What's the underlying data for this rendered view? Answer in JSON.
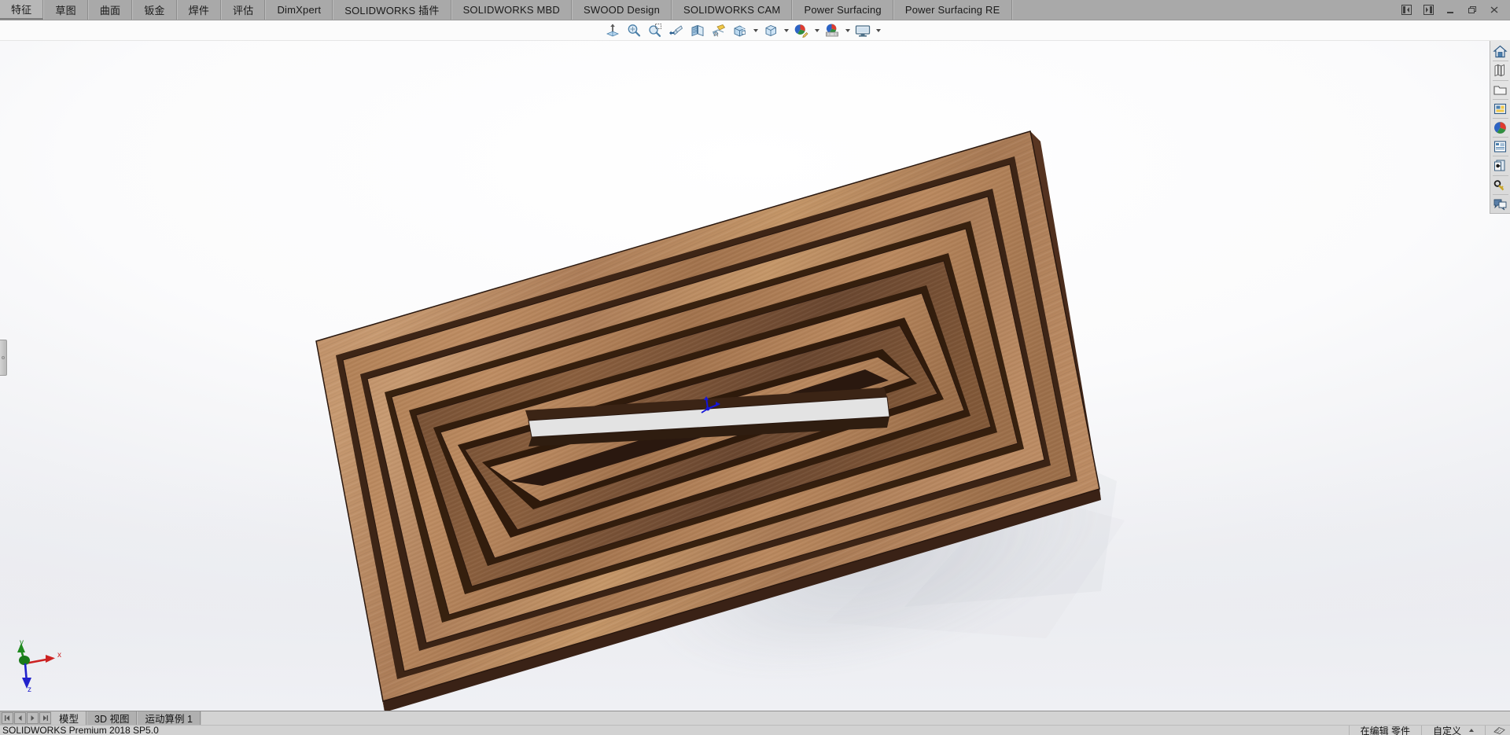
{
  "app": {
    "title": "SOLIDWORKS Premium 2018 SP5.0",
    "accent": "#a9a9a9",
    "viewport_bg": "#eef0f4"
  },
  "command_tabs": [
    {
      "label": "特征",
      "name": "tab-features",
      "active": true
    },
    {
      "label": "草图",
      "name": "tab-sketch",
      "active": false
    },
    {
      "label": "曲面",
      "name": "tab-surfaces",
      "active": false
    },
    {
      "label": "钣金",
      "name": "tab-sheet-metal",
      "active": false
    },
    {
      "label": "焊件",
      "name": "tab-weldments",
      "active": false
    },
    {
      "label": "评估",
      "name": "tab-evaluate",
      "active": false
    },
    {
      "label": "DimXpert",
      "name": "tab-dimxpert",
      "active": false
    },
    {
      "label": "SOLIDWORKS 插件",
      "name": "tab-solidworks-addins",
      "active": false
    },
    {
      "label": "SOLIDWORKS MBD",
      "name": "tab-solidworks-mbd",
      "active": false
    },
    {
      "label": "SWOOD Design",
      "name": "tab-swood-design",
      "active": false
    },
    {
      "label": "SOLIDWORKS CAM",
      "name": "tab-solidworks-cam",
      "active": false
    },
    {
      "label": "Power Surfacing",
      "name": "tab-power-surfacing",
      "active": false
    },
    {
      "label": "Power Surfacing RE",
      "name": "tab-power-surfacing-re",
      "active": false
    }
  ],
  "window_controls": [
    {
      "icon": "panel-collapse-left-icon",
      "name": "panel-collapse-left-button"
    },
    {
      "icon": "panel-collapse-right-icon",
      "name": "panel-collapse-right-button"
    },
    {
      "icon": "minimize-icon",
      "name": "minimize-button"
    },
    {
      "icon": "restore-icon",
      "name": "restore-button"
    },
    {
      "icon": "close-icon",
      "name": "close-button"
    }
  ],
  "view_toolbar": [
    {
      "icon": "zoom-to-fit-icon",
      "name": "zoom-to-fit-button",
      "tip": "整屏显示全图",
      "caret": false
    },
    {
      "icon": "zoom-to-area-icon",
      "name": "zoom-to-area-button",
      "tip": "局部放大",
      "caret": false
    },
    {
      "icon": "zoom-in-out-icon",
      "name": "zoom-in-out-button",
      "tip": "放大或缩小",
      "caret": false
    },
    {
      "icon": "previous-view-icon",
      "name": "previous-view-button",
      "tip": "上一视图",
      "caret": false
    },
    {
      "icon": "section-view-icon",
      "name": "section-view-button",
      "tip": "剖面视图",
      "caret": false
    },
    {
      "icon": "view-orientation-icon",
      "name": "view-orientation-button",
      "tip": "视图定向",
      "caret": false
    },
    {
      "icon": "display-style-icon",
      "name": "display-style-button",
      "tip": "显示样式",
      "caret": true
    },
    {
      "icon": "hide-show-items-icon",
      "name": "hide-show-items-button",
      "tip": "隐藏/显示项目",
      "caret": true
    },
    {
      "icon": "edit-appearance-icon",
      "name": "edit-appearance-button",
      "tip": "编辑外观",
      "caret": true
    },
    {
      "icon": "apply-scene-icon",
      "name": "apply-scene-button",
      "tip": "应用布景",
      "caret": true
    },
    {
      "icon": "view-settings-icon",
      "name": "view-settings-button",
      "tip": "视图设定",
      "caret": true
    }
  ],
  "task_pane": [
    {
      "icon": "home-icon",
      "name": "task-pane-sw-resources"
    },
    {
      "icon": "design-library-icon",
      "name": "task-pane-design-library"
    },
    {
      "icon": "file-explorer-icon",
      "name": "task-pane-file-explorer"
    },
    {
      "icon": "view-palette-icon",
      "name": "task-pane-view-palette"
    },
    {
      "icon": "appearances-scenes-icon",
      "name": "task-pane-appearances-scenes"
    },
    {
      "icon": "custom-properties-icon",
      "name": "task-pane-custom-properties"
    },
    {
      "icon": "swood-icon",
      "name": "task-pane-swood"
    },
    {
      "icon": "solidworks-forum-key-icon",
      "name": "task-pane-license"
    },
    {
      "icon": "forum-icon",
      "name": "task-pane-forum"
    }
  ],
  "left_panel": {
    "grip_name": "feature-manager-expand-grip"
  },
  "graphics": {
    "triad": {
      "x_label": "x",
      "y_label": "y",
      "z_label": "z",
      "x_color": "#cc2222",
      "y_color": "#1f8a1f",
      "z_color": "#2222cc"
    },
    "origin_name": "model-origin-marker",
    "model_name": "wood-nested-rectangular-spiral-part",
    "model_description": "木纹矩形螺旋零件",
    "material_colors": {
      "wood_light": "#c89a73",
      "wood_mid": "#a87a55",
      "wood_dark": "#4a2d1c",
      "edge": "#2a180f"
    }
  },
  "bottom_tabs": {
    "nav_buttons": [
      {
        "icon": "nav-first-icon",
        "name": "tab-nav-first"
      },
      {
        "icon": "nav-prev-icon",
        "name": "tab-nav-prev"
      },
      {
        "icon": "nav-next-icon",
        "name": "tab-nav-next"
      },
      {
        "icon": "nav-last-icon",
        "name": "tab-nav-last"
      }
    ],
    "tabs": [
      {
        "label": "模型",
        "name": "doc-tab-model",
        "active": true
      },
      {
        "label": "3D 视图",
        "name": "doc-tab-3d-views",
        "active": false
      },
      {
        "label": "运动算例 1",
        "name": "doc-tab-motion-study-1",
        "active": false
      }
    ]
  },
  "status_bar": {
    "left": "SOLIDWORKS Premium 2018 SP5.0",
    "editing": "在编辑 零件",
    "custom": "自定义",
    "custom_caret": "▲",
    "icon": "overlay-icon"
  }
}
